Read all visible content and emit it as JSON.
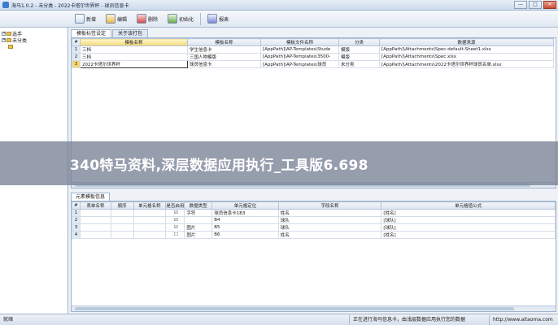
{
  "window": {
    "title": "海马1.0.2 - 未分类 - 2022卡塔尔世界杯 - 球员信息卡",
    "minimize_label": "—",
    "maximize_label": "□",
    "close_label": "✕"
  },
  "toolbar": {
    "new_label": "新增",
    "edit_label": "编辑",
    "delete_label": "删除",
    "init_label": "初始化",
    "report_label": "报表"
  },
  "tree": {
    "root_expander": "+",
    "items": [
      {
        "label": "选手",
        "level": 0,
        "expander": "+"
      },
      {
        "label": "未分类",
        "level": 0,
        "expander": "+"
      },
      {
        "label": "",
        "level": 1,
        "expander": ""
      }
    ]
  },
  "tabs": [
    "模板标签设定",
    "关于该打包"
  ],
  "template_grid": {
    "headers": [
      "#",
      "模板名称",
      "模板名称",
      "模板文件名称",
      "分类",
      "数据来源"
    ],
    "rows": [
      {
        "n": "1",
        "cells": [
          "三档",
          "学生信息卡",
          "[AppPath]\\AP-Templates\\Stude",
          "模版",
          "[AppPath]\\Attachments\\Spec-default-Sheet1.xlsx"
        ]
      },
      {
        "n": "2",
        "cells": [
          "三档",
          "三国人物模版",
          "[AppPath]\\AP-Templates\\3500-",
          "模版",
          "[AppPath]\\Attachments\\Spec.xlsx"
        ]
      },
      {
        "n": "3",
        "cells": [
          "2022卡塔尔世界杯",
          "球员信息卡",
          "[AppPath]\\AP-Templates\\球员",
          "未分类",
          "[AppPath]\\Attachments\\2022卡塔尔世界杯球员名单.xlsx"
        ]
      }
    ]
  },
  "bottom_tab": "元素模板信息",
  "field_grid": {
    "headers": [
      "#",
      "表单名称",
      "顺序",
      "单元格名称",
      "是否启用",
      "数据类型",
      "单元格定位",
      "字段名称",
      "单元格值公式"
    ],
    "rows": [
      {
        "n": "1",
        "cells": [
          "",
          "",
          "",
          "☑",
          "字符",
          "球员信息卡1B3",
          "姓名",
          "[姓名]"
        ]
      },
      {
        "n": "2",
        "cells": [
          "",
          "",
          "",
          "☑",
          "",
          "B4",
          "球队",
          "[球队]"
        ]
      },
      {
        "n": "3",
        "cells": [
          "",
          "",
          "",
          "☑",
          "图片",
          "B5",
          "球队",
          "[球队]"
        ]
      },
      {
        "n": "4",
        "cells": [
          "",
          "",
          "",
          "☐",
          "图片",
          "B6",
          "姓名",
          "[姓名]"
        ]
      }
    ]
  },
  "status": {
    "left": "就绪",
    "middle": "正在进行海马信息卡，由浅层数据应用执行您的数据",
    "right": "http://www.aitaoma.com"
  },
  "banner": {
    "text": "340特马资料,深层数据应用执行_工具版6.698"
  }
}
